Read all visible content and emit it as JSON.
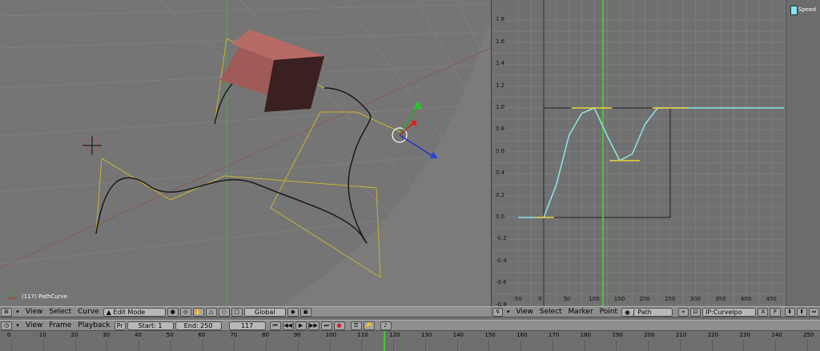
{
  "viewport": {
    "object_label": "(117) PathCurve"
  },
  "header_3d": {
    "menus": [
      "View",
      "Select",
      "Curve"
    ],
    "mode": "Edit Mode",
    "orientation": "Global"
  },
  "ipo": {
    "y_ticks": [
      "1.8",
      "1.6",
      "1.4",
      "1.2",
      "1.0",
      "0.8",
      "0.6",
      "0.4",
      "0.2",
      "0.0",
      "-0.2",
      "-0.4",
      "-0.6",
      "-0.8"
    ],
    "x_ticks": [
      "-50",
      "0",
      "50",
      "100",
      "150",
      "200",
      "250",
      "300",
      "350",
      "400",
      "450"
    ],
    "channel": "Speed",
    "channel_color": "#7fe8f0",
    "curve_color": "#8fe6e8",
    "handle_color": "#e8d23a",
    "current_frame_color": "#49c63a",
    "chart_data": {
      "type": "line",
      "series": [
        {
          "name": "Speed",
          "x": [
            -50,
            0,
            25,
            50,
            75,
            100,
            125,
            150,
            175,
            200,
            225,
            250,
            300,
            475
          ],
          "y": [
            0,
            0,
            0.3,
            0.75,
            0.95,
            1.0,
            0.75,
            0.52,
            0.58,
            0.85,
            1.0,
            1.0,
            1.0,
            1.0
          ]
        }
      ],
      "xlim": [
        -50,
        475
      ],
      "ylim": [
        -0.8,
        1.8
      ]
    }
  },
  "header_ipo": {
    "menus": [
      "View",
      "Select",
      "Marker",
      "Point"
    ],
    "type": "Path",
    "ipo_name": "IP:Curvelpo",
    "x_btn": "X",
    "f_btn": "F"
  },
  "header_time": {
    "menus": [
      "View",
      "Frame",
      "Playback"
    ],
    "pr": "Pr",
    "start": "Start: 1",
    "end": "End: 250",
    "current": "117"
  },
  "timeline": {
    "ticks": [
      "0",
      "10",
      "20",
      "30",
      "40",
      "50",
      "60",
      "70",
      "80",
      "90",
      "100",
      "110",
      "120",
      "130",
      "140",
      "150",
      "160",
      "170",
      "180",
      "190",
      "200",
      "210",
      "220",
      "230",
      "240",
      "250"
    ],
    "current": 117
  }
}
